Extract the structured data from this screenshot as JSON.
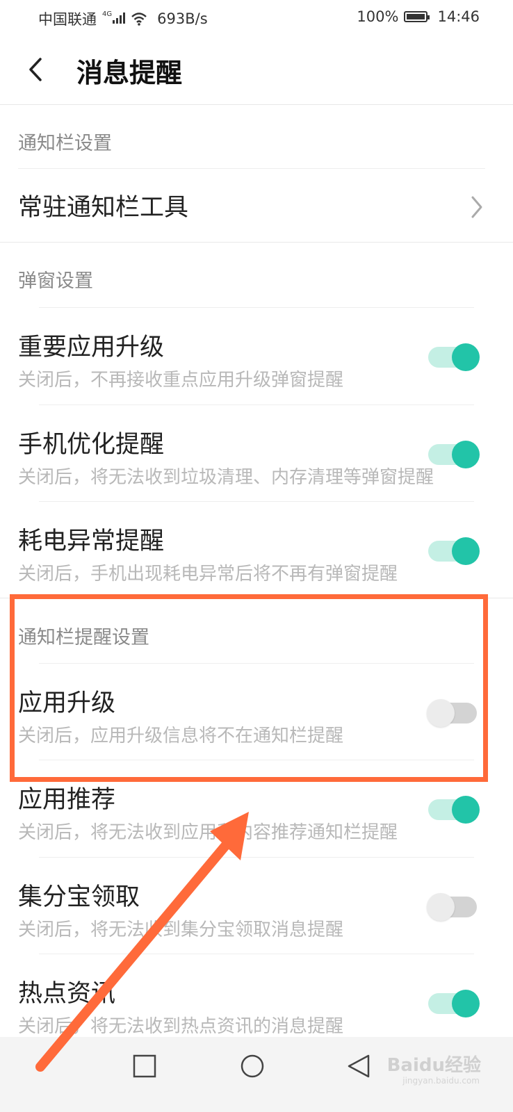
{
  "status_bar": {
    "carrier": "中国联通",
    "network_type": "4G",
    "speed": "693B/s",
    "battery": "100%",
    "time": "14:46"
  },
  "header": {
    "title": "消息提醒",
    "back_icon": "chevron-left-icon"
  },
  "sections": {
    "notification_bar": {
      "title": "通知栏设置",
      "item_label": "常驻通知栏工具"
    },
    "popup": {
      "title": "弹窗设置",
      "items": [
        {
          "title": "重要应用升级",
          "desc": "关闭后，不再接收重点应用升级弹窗提醒",
          "on": true
        },
        {
          "title": "手机优化提醒",
          "desc": "关闭后，将无法收到垃圾清理、内存清理等弹窗提醒",
          "on": true
        },
        {
          "title": "耗电异常提醒",
          "desc": "关闭后，手机出现耗电异常后将不再有弹窗提醒",
          "on": true
        }
      ]
    },
    "notification_reminder": {
      "title": "通知栏提醒设置",
      "items": [
        {
          "title": "应用升级",
          "desc": "关闭后，应用升级信息将不在通知栏提醒",
          "on": false
        },
        {
          "title": "应用推荐",
          "desc": "关闭后，将无法收到应用和内容推荐通知栏提醒",
          "on": true
        },
        {
          "title": "集分宝领取",
          "desc": "关闭后，将无法收到集分宝领取消息提醒",
          "on": false
        },
        {
          "title": "热点资讯",
          "desc": "关闭后，将无法收到热点资讯的消息提醒",
          "on": true
        }
      ]
    }
  },
  "colors": {
    "toggle_on_track": "#c4efe4",
    "toggle_on_knob": "#22c4a8",
    "toggle_off_track": "#d3d3d3",
    "highlight": "#ff6a3a"
  },
  "watermark": {
    "brand": "Baidu经验",
    "url": "jingyan.baidu.com"
  }
}
